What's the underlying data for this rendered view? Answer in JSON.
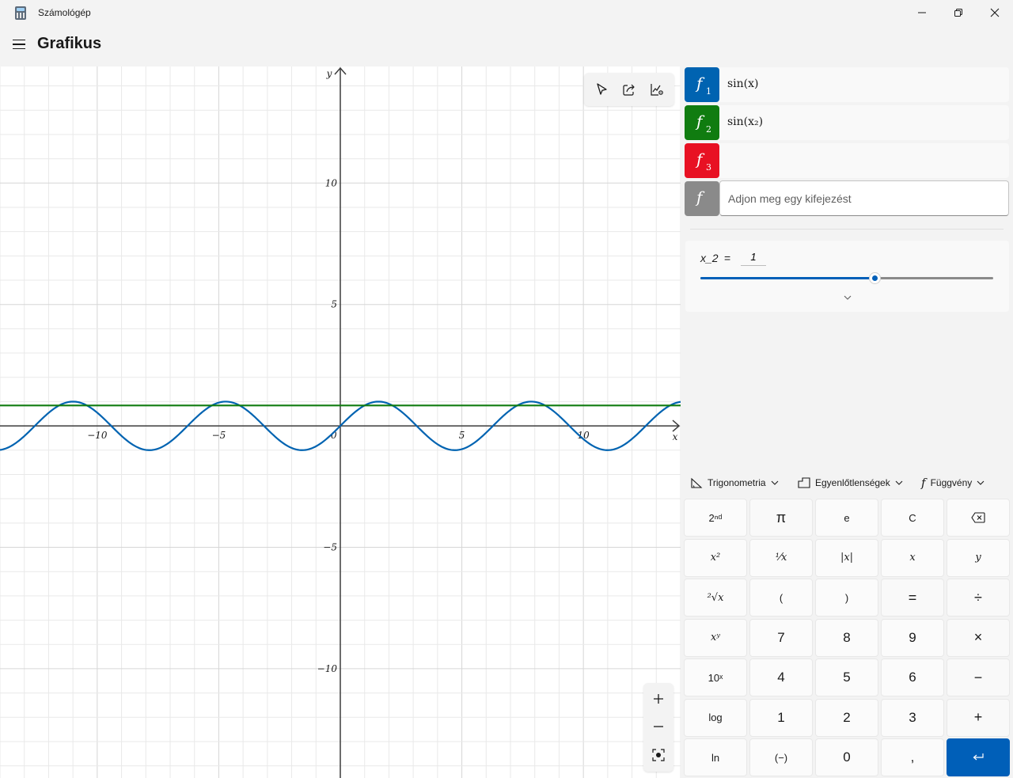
{
  "window": {
    "title": "Számológép",
    "icon": "calculator-icon",
    "controls": [
      "minimize-icon",
      "restore-icon",
      "close-icon"
    ]
  },
  "header": {
    "menu_icon": "hamburger-icon",
    "mode": "Grafikus"
  },
  "graph_toolbar": {
    "buttons": [
      "select-trace-icon",
      "share-icon",
      "graph-options-icon"
    ]
  },
  "zoom_controls": {
    "buttons": [
      "zoom-in-icon",
      "zoom-out-icon",
      "reset-view-icon"
    ]
  },
  "functions": [
    {
      "label": "f",
      "index": "1",
      "expression": "sin(x)",
      "color": "#0063b1"
    },
    {
      "label": "f",
      "index": "2",
      "expression": "sin(x₂)",
      "color": "#107c10"
    },
    {
      "label": "f",
      "index": "3",
      "expression": "",
      "color": "#e81123"
    }
  ],
  "new_function": {
    "label": "f",
    "color": "#8a8a8a",
    "placeholder": "Adjon meg egy kifejezést"
  },
  "variable": {
    "name": "x_2",
    "equals": "=",
    "value": "1",
    "slider_fraction": 0.595
  },
  "keypad_tabs": [
    {
      "icon": "trigonometry-icon",
      "label": "Trigonometria"
    },
    {
      "icon": "inequality-icon",
      "label": "Egyenlőtlenségek"
    },
    {
      "icon": "function-icon",
      "label": "Függvény"
    }
  ],
  "keypad": [
    [
      "2ⁿᵈ",
      "π",
      "e",
      "C",
      "⌫"
    ],
    [
      "x²",
      "¹⁄x",
      "|x|",
      "x",
      "y"
    ],
    [
      "²√x",
      "(",
      ")",
      "=",
      "÷"
    ],
    [
      "xʸ",
      "7",
      "8",
      "9",
      "×"
    ],
    [
      "10ˣ",
      "4",
      "5",
      "6",
      "−"
    ],
    [
      "log",
      "1",
      "2",
      "3",
      "+"
    ],
    [
      "ln",
      "(−)",
      "0",
      ",",
      "↵"
    ]
  ],
  "chart_data": {
    "type": "line",
    "xlabel": "x",
    "ylabel": "y",
    "xlim": [
      -14,
      14
    ],
    "ylim": [
      -14.5,
      14.8
    ],
    "grid": true,
    "x_ticks": [
      -10,
      -5,
      0,
      5,
      10
    ],
    "y_ticks": [
      10,
      5,
      -5,
      -10
    ],
    "x_tick_labels": [
      "−10",
      "−5",
      "0",
      "5",
      "10"
    ],
    "y_tick_labels": [
      "10",
      "5",
      "−5",
      "−10"
    ],
    "series": [
      {
        "name": "sin(x)",
        "color": "#0063b1",
        "function": "sin(x)"
      },
      {
        "name": "sin(x₂)",
        "color": "#107c10",
        "constant": 0.841
      }
    ]
  }
}
